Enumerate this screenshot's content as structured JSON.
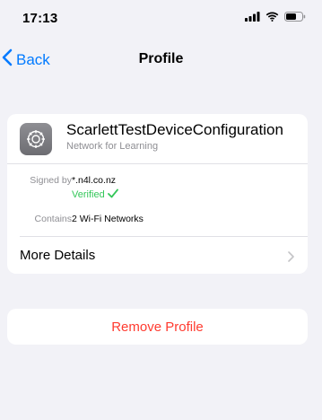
{
  "status_bar": {
    "time": "17:13",
    "icons": [
      "cellular-signal-icon",
      "wifi-icon",
      "battery-icon"
    ]
  },
  "nav": {
    "back_label": "Back",
    "title": "Profile"
  },
  "profile": {
    "icon": "gear-icon",
    "name": "ScarlettTestDeviceConfiguration",
    "organization": "Network for Learning",
    "signed_by_label": "Signed by",
    "signed_by_value": "*.n4l.co.nz",
    "verified_label": "Verified",
    "contains_label": "Contains",
    "contains_value": "2 Wi-Fi Networks",
    "more_details_label": "More Details"
  },
  "actions": {
    "remove_label": "Remove Profile"
  },
  "colors": {
    "accent": "#007aff",
    "destructive": "#ff3b30",
    "verified": "#34c759",
    "background": "#f2f2f7",
    "secondary_text": "#8e8e93"
  }
}
